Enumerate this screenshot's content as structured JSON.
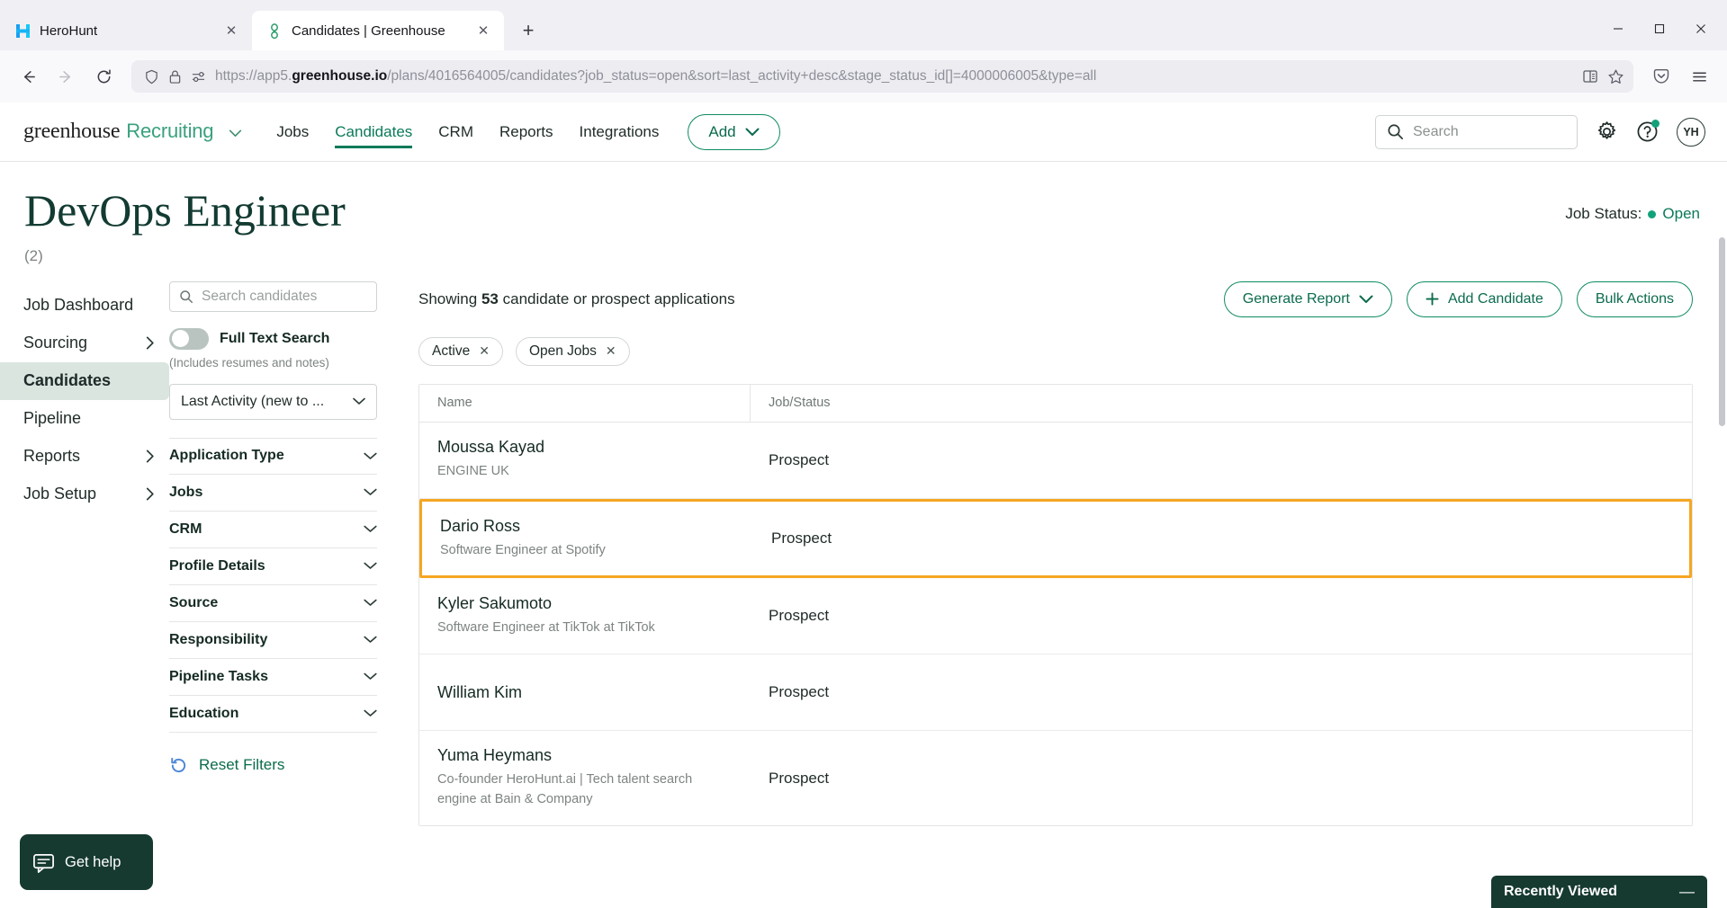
{
  "browser": {
    "tabs": [
      {
        "title": "HeroHunt",
        "favicon": "herohunt-logo-icon",
        "active": false
      },
      {
        "title": "Candidates | Greenhouse",
        "favicon": "greenhouse-favicon-icon",
        "active": true
      }
    ],
    "new_tab_label": "+",
    "url": {
      "prefix": "https://app5.",
      "domain": "greenhouse.io",
      "path": "/plans/4016564005/candidates?job_status=open&sort=last_activity+desc&stage_status_id[]=4000006005&type=all"
    },
    "window_controls": {
      "minimize": "—",
      "maximize": "❐",
      "close": "✕"
    }
  },
  "topnav": {
    "logo_greenhouse": "greenhouse",
    "logo_recruiting": "Recruiting",
    "links": [
      {
        "label": "Jobs",
        "active": false
      },
      {
        "label": "Candidates",
        "active": true
      },
      {
        "label": "CRM",
        "active": false
      },
      {
        "label": "Reports",
        "active": false
      },
      {
        "label": "Integrations",
        "active": false
      }
    ],
    "add_button": "Add",
    "search_placeholder": "Search",
    "avatar_initials": "YH"
  },
  "header": {
    "title": "DevOps Engineer",
    "count": "(2)",
    "status_label": "Job Status:",
    "status_value": "Open"
  },
  "leftnav": {
    "items": [
      {
        "label": "Job Dashboard",
        "active": false,
        "chevron": false
      },
      {
        "label": "Sourcing",
        "active": false,
        "chevron": true
      },
      {
        "label": "Candidates",
        "active": true,
        "chevron": false
      },
      {
        "label": "Pipeline",
        "active": false,
        "chevron": false
      },
      {
        "label": "Reports",
        "active": false,
        "chevron": true
      },
      {
        "label": "Job Setup",
        "active": false,
        "chevron": true
      }
    ]
  },
  "filters": {
    "search_placeholder": "Search candidates",
    "full_text_search_label": "Full Text Search",
    "full_text_search_enabled": false,
    "full_text_note": "(Includes resumes and notes)",
    "sort_selected": "Last Activity (new to ...",
    "accordions": [
      "Application Type",
      "Jobs",
      "CRM",
      "Profile Details",
      "Source",
      "Responsibility",
      "Pipeline Tasks",
      "Education"
    ],
    "reset_label": "Reset Filters"
  },
  "main": {
    "showing_prefix": "Showing",
    "showing_count": "53",
    "showing_suffix": "candidate or prospect applications",
    "buttons": {
      "generate_report": "Generate Report",
      "add_candidate": "Add Candidate",
      "bulk_actions": "Bulk Actions"
    },
    "chips": [
      {
        "label": "Active"
      },
      {
        "label": "Open Jobs"
      }
    ],
    "table": {
      "columns": [
        "Name",
        "Job/Status"
      ],
      "rows": [
        {
          "name": "Moussa Kayad",
          "subtitle": "ENGINE UK",
          "status": "Prospect",
          "highlighted": false
        },
        {
          "name": "Dario Ross",
          "subtitle": "Software Engineer at Spotify",
          "status": "Prospect",
          "highlighted": true
        },
        {
          "name": "Kyler Sakumoto",
          "subtitle": "Software Engineer at TikTok at TikTok",
          "status": "Prospect",
          "highlighted": false
        },
        {
          "name": "William Kim",
          "subtitle": "",
          "status": "Prospect",
          "highlighted": false
        },
        {
          "name": "Yuma Heymans",
          "subtitle": "Co-founder HeroHunt.ai | Tech talent search engine at Bain & Company",
          "status": "Prospect",
          "highlighted": false
        }
      ]
    }
  },
  "widgets": {
    "get_help": "Get help",
    "recently_viewed": "Recently Viewed",
    "recently_viewed_minimize": "—"
  },
  "colors": {
    "accent_green": "#0b7a5a",
    "brand_dark_green": "#123b32",
    "highlight_orange": "#f5a623",
    "status_green": "#12a27a"
  }
}
